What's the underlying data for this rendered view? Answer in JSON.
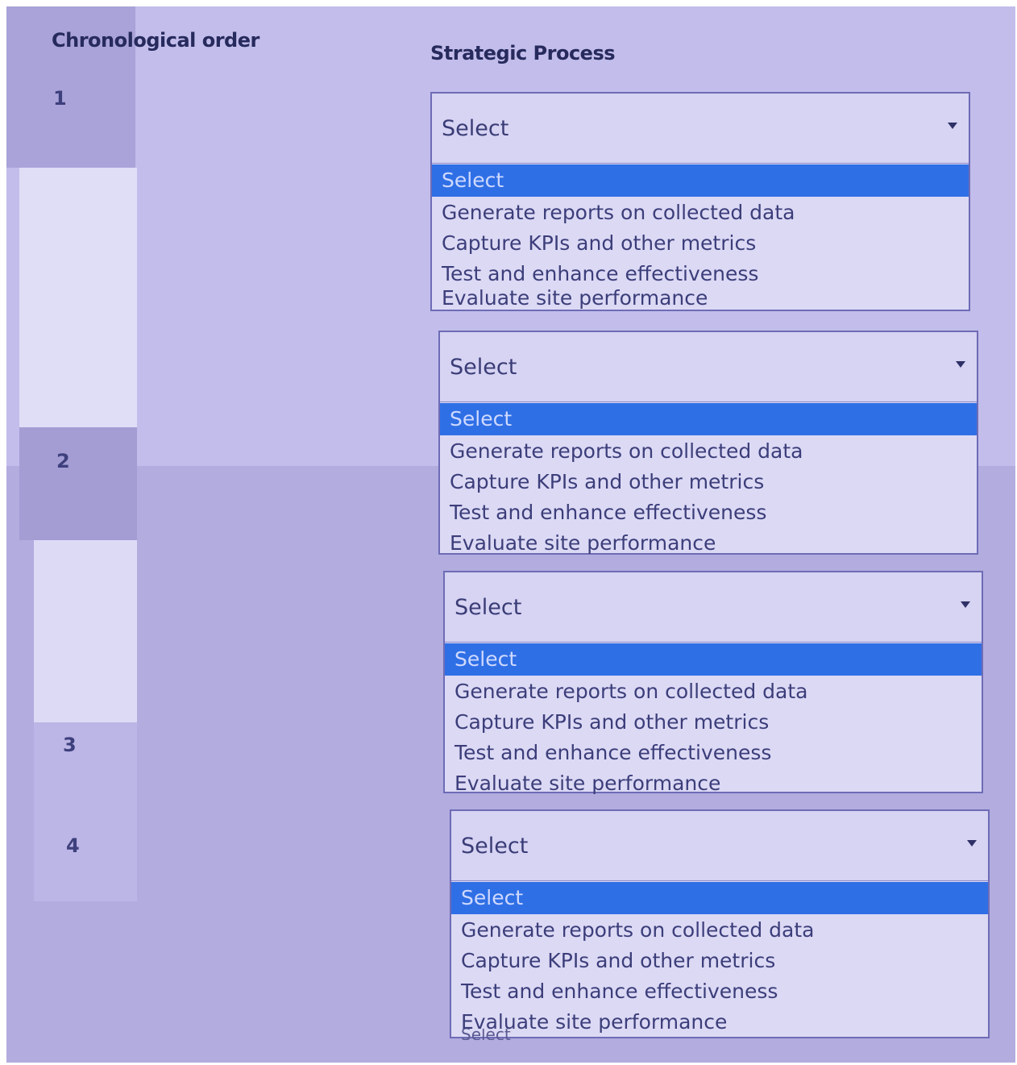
{
  "headers": {
    "order": "Chronological order",
    "process": "Strategic Process"
  },
  "rows": [
    {
      "number": "1",
      "selected": "Select"
    },
    {
      "number": "2",
      "selected": "Select"
    },
    {
      "number": "3",
      "selected": "Select"
    },
    {
      "number": "4",
      "selected": "Select"
    }
  ],
  "options": [
    "Select",
    "Generate reports on collected data",
    "Capture KPIs and other metrics",
    "Test and enhance effectiveness",
    "Evaluate site performance"
  ],
  "extra_option": "Select",
  "colors": {
    "background": "#b2acdf",
    "highlight": "#2f6fe6"
  }
}
